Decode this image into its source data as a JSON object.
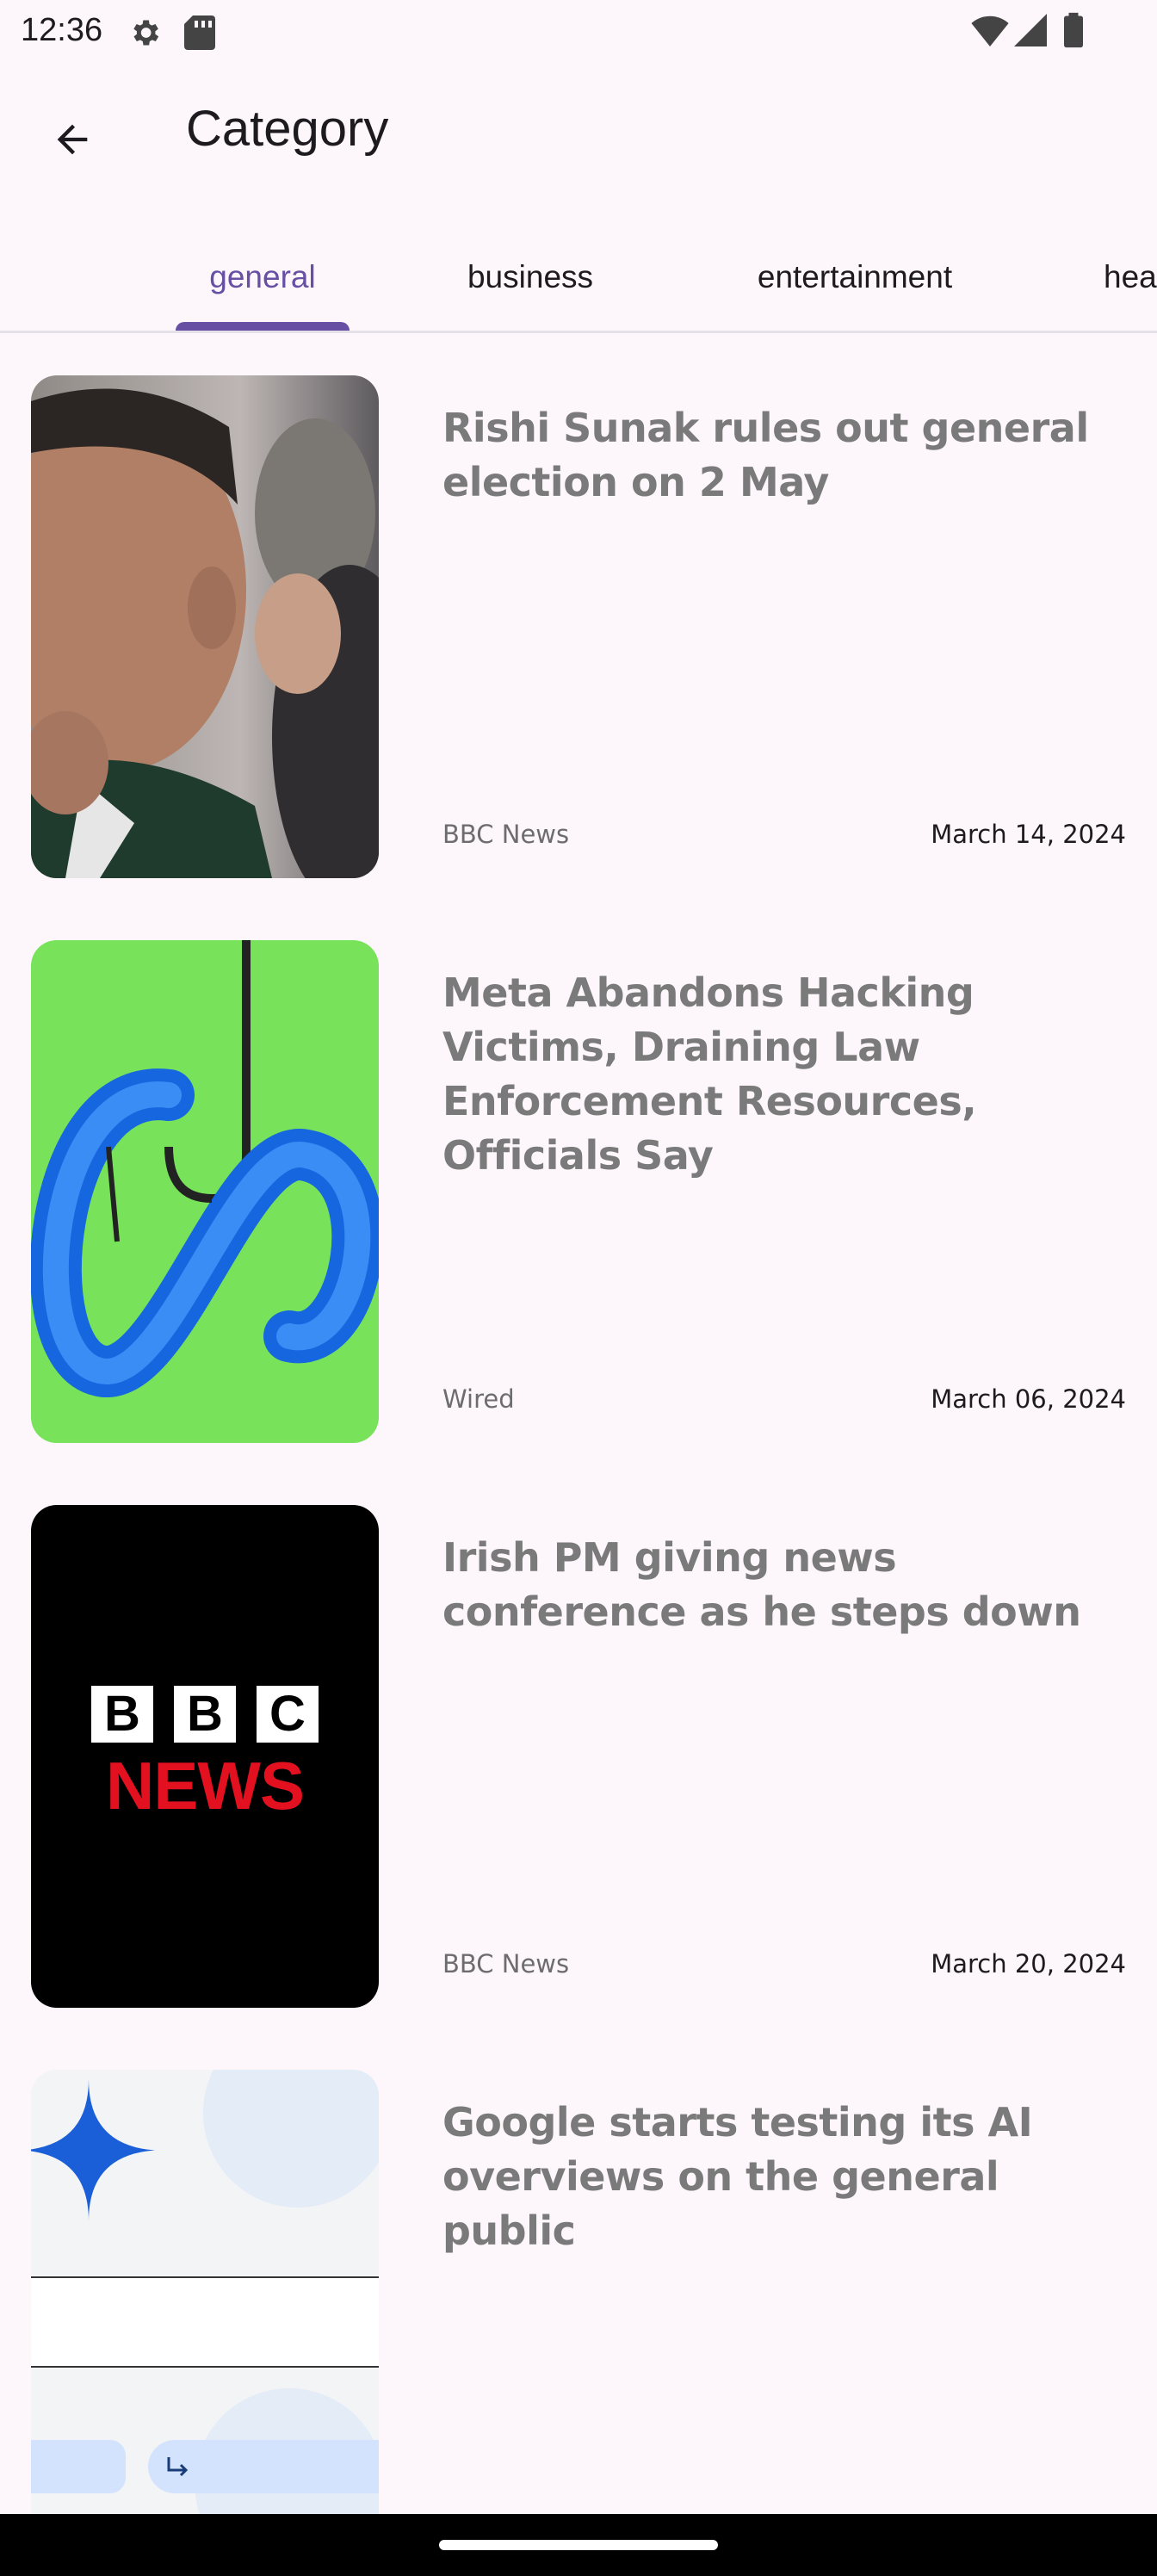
{
  "status_bar": {
    "time": "12:36",
    "icons_left": [
      "settings-icon",
      "sd-card-icon"
    ],
    "icons_right": [
      "wifi-icon",
      "signal-icon",
      "battery-icon"
    ]
  },
  "app_bar": {
    "title": "Category",
    "back_icon": "arrow-back-icon"
  },
  "tabs": [
    {
      "label": "general",
      "active": true
    },
    {
      "label": "business",
      "active": false
    },
    {
      "label": "entertainment",
      "active": false
    },
    {
      "label": "hea",
      "active": false
    }
  ],
  "articles": [
    {
      "title": "Rishi Sunak rules out general election on 2 May",
      "source": "BBC News",
      "date": "March 14, 2024",
      "image": "portrait-photo"
    },
    {
      "title": "Meta Abandons Hacking Victims, Draining Law Enforcement Resources, Officials Say",
      "source": "Wired",
      "date": "March 06, 2024",
      "image": "meta-logo-fishhook-illustration"
    },
    {
      "title": "Irish PM giving news conference as he steps down",
      "source": "BBC News",
      "date": "March 20, 2024",
      "image": "bbc-news-logo",
      "image_text": {
        "bbc": [
          "B",
          "B",
          "C"
        ],
        "news": "NEWS"
      }
    },
    {
      "title": "Google starts testing its AI overviews on the general public",
      "source": "",
      "date": "",
      "image": "google-ai-screenshot"
    }
  ],
  "colors": {
    "background": "#fdf7fb",
    "accent": "#6750a4",
    "title_text": "#7a7a7a",
    "bbc_red": "#e3101f"
  }
}
